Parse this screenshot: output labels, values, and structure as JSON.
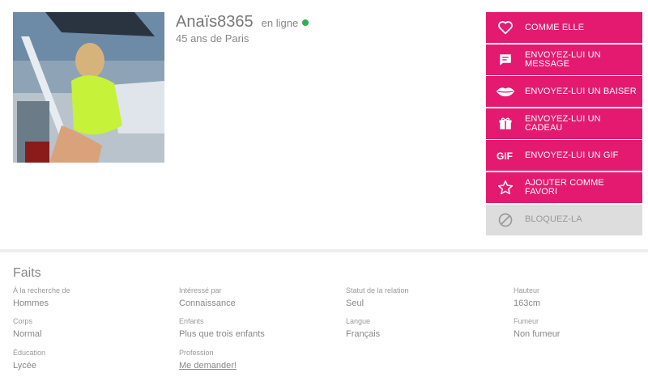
{
  "profile": {
    "username": "Anaïs8365",
    "status": "en ligne",
    "subtitle": "45 ans de Paris"
  },
  "actions": [
    {
      "label": "COMME ELLE",
      "icon": "heart-icon"
    },
    {
      "label": "ENVOYEZ-LUI UN MESSAGE",
      "icon": "chat-bubble-icon"
    },
    {
      "label": "ENVOYEZ-LUI UN BAISER",
      "icon": "lips-icon"
    },
    {
      "label": "ENVOYEZ-LUI UN CADEAU",
      "icon": "gift-icon"
    },
    {
      "label": "ENVOYEZ-LUI UN GIF",
      "icon": "gif-icon"
    },
    {
      "label": "AJOUTER COMME FAVORI",
      "icon": "star-icon"
    },
    {
      "label": "BLOQUEZ-LA",
      "icon": "block-icon"
    }
  ],
  "facts": {
    "title": "Faits",
    "items": [
      {
        "key": "À la recherche de",
        "value": "Hommes"
      },
      {
        "key": "Intéressé par",
        "value": "Connaissance"
      },
      {
        "key": "Statut de la relation",
        "value": "Seul"
      },
      {
        "key": "Hauteur",
        "value": "163cm"
      },
      {
        "key": "Corps",
        "value": "Normal"
      },
      {
        "key": "Enfants",
        "value": "Plus que trois enfants"
      },
      {
        "key": "Langue",
        "value": "Français"
      },
      {
        "key": "Fumeur",
        "value": "Non fumeur"
      },
      {
        "key": "Éducation",
        "value": "Lycée"
      },
      {
        "key": "Profession",
        "value": "Me demander!"
      }
    ]
  },
  "colors": {
    "accent": "#e41a70",
    "online": "#2bb24c",
    "block_bg": "#dddddd"
  }
}
